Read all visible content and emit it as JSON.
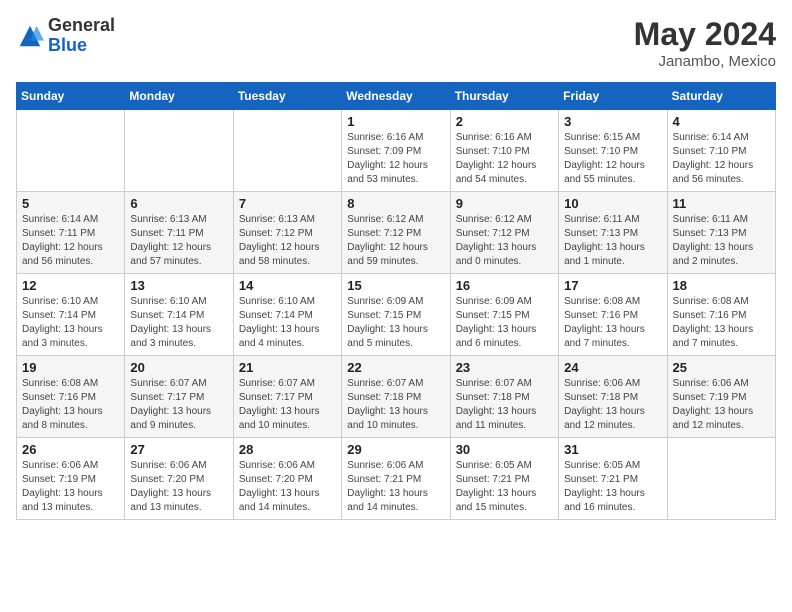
{
  "header": {
    "logo_general": "General",
    "logo_blue": "Blue",
    "month_year": "May 2024",
    "location": "Janambo, Mexico"
  },
  "calendar": {
    "days_of_week": [
      "Sunday",
      "Monday",
      "Tuesday",
      "Wednesday",
      "Thursday",
      "Friday",
      "Saturday"
    ],
    "weeks": [
      [
        {
          "day": "",
          "info": ""
        },
        {
          "day": "",
          "info": ""
        },
        {
          "day": "",
          "info": ""
        },
        {
          "day": "1",
          "info": "Sunrise: 6:16 AM\nSunset: 7:09 PM\nDaylight: 12 hours\nand 53 minutes."
        },
        {
          "day": "2",
          "info": "Sunrise: 6:16 AM\nSunset: 7:10 PM\nDaylight: 12 hours\nand 54 minutes."
        },
        {
          "day": "3",
          "info": "Sunrise: 6:15 AM\nSunset: 7:10 PM\nDaylight: 12 hours\nand 55 minutes."
        },
        {
          "day": "4",
          "info": "Sunrise: 6:14 AM\nSunset: 7:10 PM\nDaylight: 12 hours\nand 56 minutes."
        }
      ],
      [
        {
          "day": "5",
          "info": "Sunrise: 6:14 AM\nSunset: 7:11 PM\nDaylight: 12 hours\nand 56 minutes."
        },
        {
          "day": "6",
          "info": "Sunrise: 6:13 AM\nSunset: 7:11 PM\nDaylight: 12 hours\nand 57 minutes."
        },
        {
          "day": "7",
          "info": "Sunrise: 6:13 AM\nSunset: 7:12 PM\nDaylight: 12 hours\nand 58 minutes."
        },
        {
          "day": "8",
          "info": "Sunrise: 6:12 AM\nSunset: 7:12 PM\nDaylight: 12 hours\nand 59 minutes."
        },
        {
          "day": "9",
          "info": "Sunrise: 6:12 AM\nSunset: 7:12 PM\nDaylight: 13 hours\nand 0 minutes."
        },
        {
          "day": "10",
          "info": "Sunrise: 6:11 AM\nSunset: 7:13 PM\nDaylight: 13 hours\nand 1 minute."
        },
        {
          "day": "11",
          "info": "Sunrise: 6:11 AM\nSunset: 7:13 PM\nDaylight: 13 hours\nand 2 minutes."
        }
      ],
      [
        {
          "day": "12",
          "info": "Sunrise: 6:10 AM\nSunset: 7:14 PM\nDaylight: 13 hours\nand 3 minutes."
        },
        {
          "day": "13",
          "info": "Sunrise: 6:10 AM\nSunset: 7:14 PM\nDaylight: 13 hours\nand 3 minutes."
        },
        {
          "day": "14",
          "info": "Sunrise: 6:10 AM\nSunset: 7:14 PM\nDaylight: 13 hours\nand 4 minutes."
        },
        {
          "day": "15",
          "info": "Sunrise: 6:09 AM\nSunset: 7:15 PM\nDaylight: 13 hours\nand 5 minutes."
        },
        {
          "day": "16",
          "info": "Sunrise: 6:09 AM\nSunset: 7:15 PM\nDaylight: 13 hours\nand 6 minutes."
        },
        {
          "day": "17",
          "info": "Sunrise: 6:08 AM\nSunset: 7:16 PM\nDaylight: 13 hours\nand 7 minutes."
        },
        {
          "day": "18",
          "info": "Sunrise: 6:08 AM\nSunset: 7:16 PM\nDaylight: 13 hours\nand 7 minutes."
        }
      ],
      [
        {
          "day": "19",
          "info": "Sunrise: 6:08 AM\nSunset: 7:16 PM\nDaylight: 13 hours\nand 8 minutes."
        },
        {
          "day": "20",
          "info": "Sunrise: 6:07 AM\nSunset: 7:17 PM\nDaylight: 13 hours\nand 9 minutes."
        },
        {
          "day": "21",
          "info": "Sunrise: 6:07 AM\nSunset: 7:17 PM\nDaylight: 13 hours\nand 10 minutes."
        },
        {
          "day": "22",
          "info": "Sunrise: 6:07 AM\nSunset: 7:18 PM\nDaylight: 13 hours\nand 10 minutes."
        },
        {
          "day": "23",
          "info": "Sunrise: 6:07 AM\nSunset: 7:18 PM\nDaylight: 13 hours\nand 11 minutes."
        },
        {
          "day": "24",
          "info": "Sunrise: 6:06 AM\nSunset: 7:18 PM\nDaylight: 13 hours\nand 12 minutes."
        },
        {
          "day": "25",
          "info": "Sunrise: 6:06 AM\nSunset: 7:19 PM\nDaylight: 13 hours\nand 12 minutes."
        }
      ],
      [
        {
          "day": "26",
          "info": "Sunrise: 6:06 AM\nSunset: 7:19 PM\nDaylight: 13 hours\nand 13 minutes."
        },
        {
          "day": "27",
          "info": "Sunrise: 6:06 AM\nSunset: 7:20 PM\nDaylight: 13 hours\nand 13 minutes."
        },
        {
          "day": "28",
          "info": "Sunrise: 6:06 AM\nSunset: 7:20 PM\nDaylight: 13 hours\nand 14 minutes."
        },
        {
          "day": "29",
          "info": "Sunrise: 6:06 AM\nSunset: 7:21 PM\nDaylight: 13 hours\nand 14 minutes."
        },
        {
          "day": "30",
          "info": "Sunrise: 6:05 AM\nSunset: 7:21 PM\nDaylight: 13 hours\nand 15 minutes."
        },
        {
          "day": "31",
          "info": "Sunrise: 6:05 AM\nSunset: 7:21 PM\nDaylight: 13 hours\nand 16 minutes."
        },
        {
          "day": "",
          "info": ""
        }
      ]
    ]
  }
}
